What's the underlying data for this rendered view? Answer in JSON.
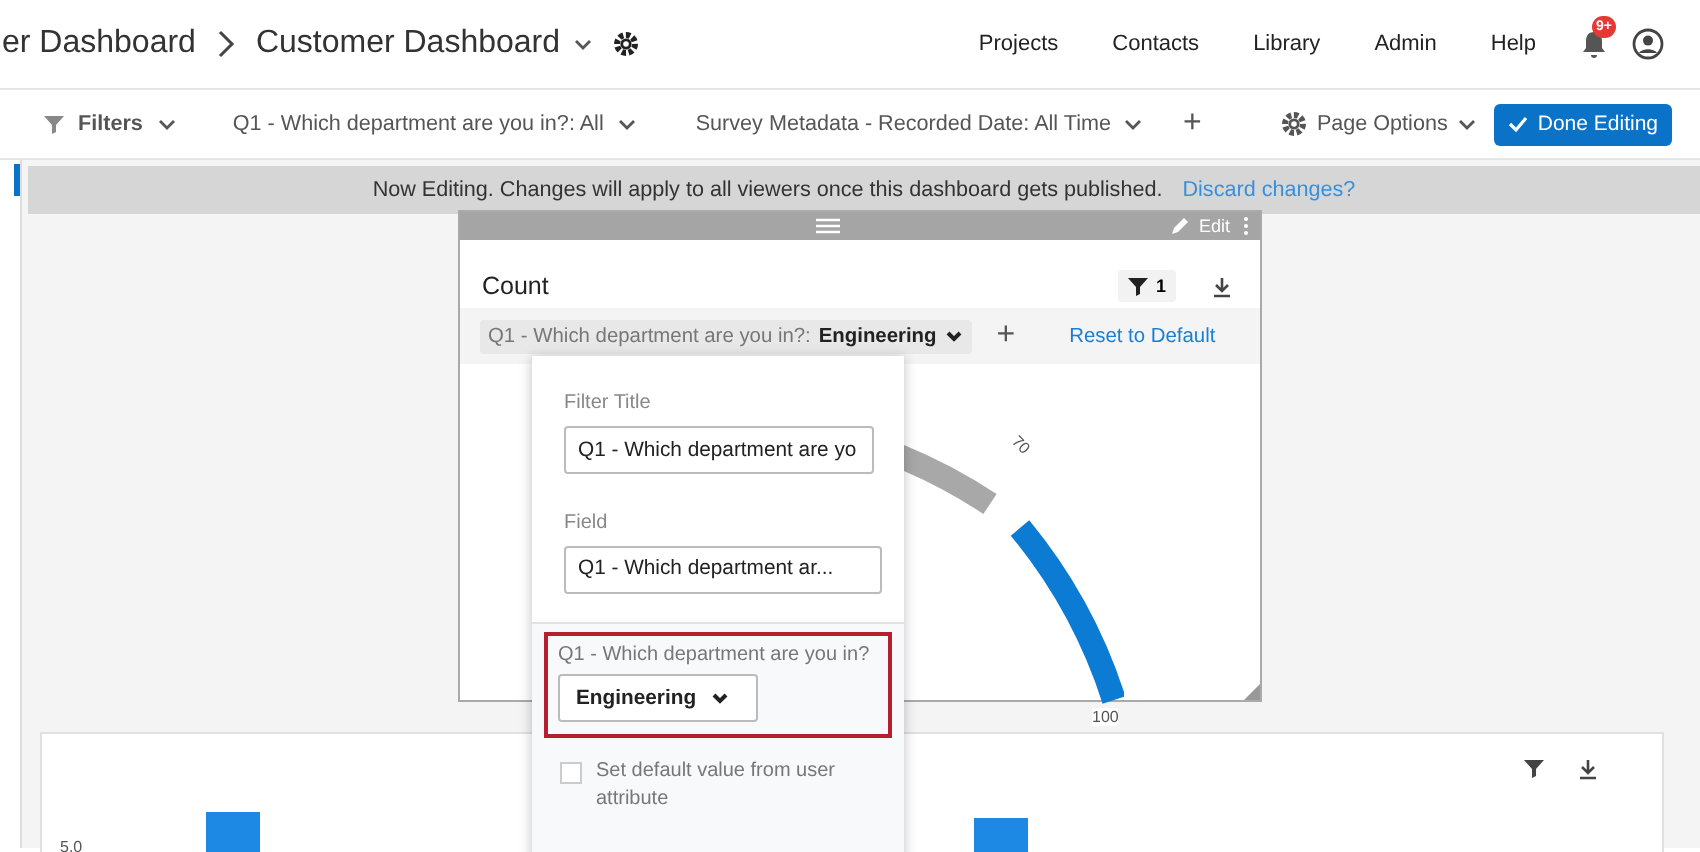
{
  "header": {
    "breadcrumbs": [
      {
        "label": "er Dashboard"
      },
      {
        "label": "Customer Dashboard"
      }
    ],
    "nav": [
      "Projects",
      "Contacts",
      "Library",
      "Admin",
      "Help"
    ],
    "notification_badge": "9+"
  },
  "filter_bar": {
    "filters_label": "Filters",
    "filters": [
      "Q1 - Which department are you in?: All",
      "Survey Metadata - Recorded Date: All Time"
    ],
    "add": "+",
    "page_options": "Page Options",
    "done_button": "Done Editing"
  },
  "banner": {
    "text": "Now Editing. Changes will apply to all viewers once this dashboard gets published.",
    "link": "Discard changes?"
  },
  "widget": {
    "edit_label": "Edit",
    "title": "Count",
    "filter_count": "1",
    "filter_chip": {
      "label": "Q1 - Which department are you in?:",
      "value": "Engineering"
    },
    "add": "+",
    "reset_link": "Reset to Default",
    "gauge_labels": [
      "70",
      "100"
    ]
  },
  "popup": {
    "filter_title_label": "Filter Title",
    "filter_title_value": "Q1 - Which department are yo",
    "field_label": "Field",
    "field_value": "Q1 - Which department ar...",
    "question_label": "Q1 - Which department are you in?",
    "dropdown_value": "Engineering",
    "highlighted": true,
    "default_checkbox": {
      "label": "Set default value from user attribute",
      "checked": false
    }
  },
  "bottom_widget": {
    "axis_label": "5.0"
  }
}
